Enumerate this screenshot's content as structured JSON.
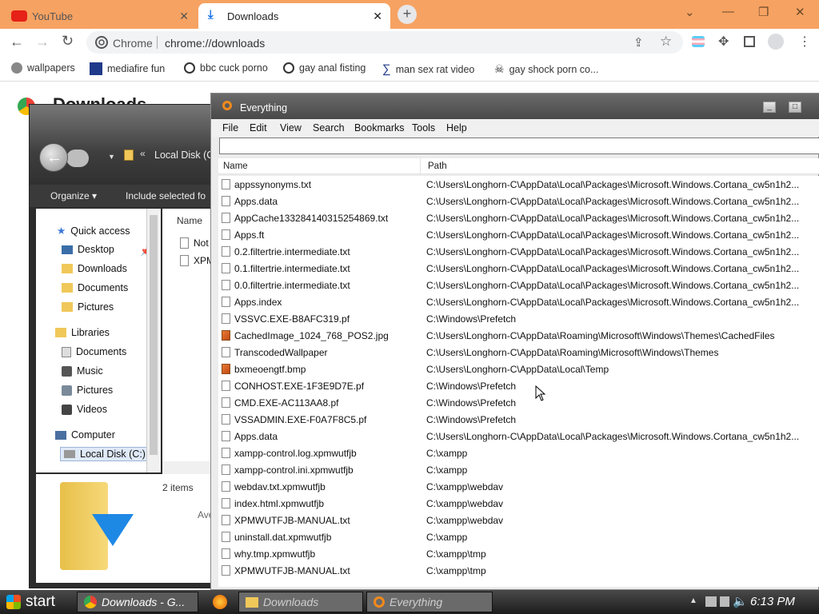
{
  "browser": {
    "tabs": [
      {
        "label": "YouTube"
      },
      {
        "label": "Downloads"
      }
    ],
    "omnibox": {
      "site_label": "Chrome",
      "url": "chrome://downloads"
    },
    "bookmarks": [
      "wallpapers",
      "mediafire fun",
      "bbc cuck porno",
      "gay anal fisting",
      "man sex rat video",
      "gay shock porn co..."
    ],
    "page_title": "Downloads"
  },
  "explorer": {
    "address": "Local Disk (C",
    "address_prefix": "«",
    "commands": {
      "organize": "Organize ▾",
      "include": "Include selected fo"
    },
    "nav": {
      "quick_access": "Quick access",
      "desktop": "Desktop",
      "downloads": "Downloads",
      "documents": "Documents",
      "pictures": "Pictures",
      "libraries": "Libraries",
      "lib_documents": "Documents",
      "music": "Music",
      "lib_pictures": "Pictures",
      "videos": "Videos",
      "computer": "Computer",
      "local_disk": "Local Disk (C:)"
    },
    "column_name": "Name",
    "files": [
      "Not",
      "XPM"
    ],
    "status": "2 items",
    "status_trailing": "Ave"
  },
  "everything": {
    "title": "Everything",
    "menu": [
      "File",
      "Edit",
      "View",
      "Search",
      "Bookmarks",
      "Tools",
      "Help"
    ],
    "search_value": "",
    "columns": {
      "name": "Name",
      "path": "Path"
    },
    "rows": [
      {
        "name": "appssynonyms.txt",
        "path": "C:\\Users\\Longhorn-C\\AppData\\Local\\Packages\\Microsoft.Windows.Cortana_cw5n1h2..."
      },
      {
        "name": "Apps.data",
        "path": "C:\\Users\\Longhorn-C\\AppData\\Local\\Packages\\Microsoft.Windows.Cortana_cw5n1h2..."
      },
      {
        "name": "AppCache133284140315254869.txt",
        "path": "C:\\Users\\Longhorn-C\\AppData\\Local\\Packages\\Microsoft.Windows.Cortana_cw5n1h2..."
      },
      {
        "name": "Apps.ft",
        "path": "C:\\Users\\Longhorn-C\\AppData\\Local\\Packages\\Microsoft.Windows.Cortana_cw5n1h2..."
      },
      {
        "name": "0.2.filtertrie.intermediate.txt",
        "path": "C:\\Users\\Longhorn-C\\AppData\\Local\\Packages\\Microsoft.Windows.Cortana_cw5n1h2..."
      },
      {
        "name": "0.1.filtertrie.intermediate.txt",
        "path": "C:\\Users\\Longhorn-C\\AppData\\Local\\Packages\\Microsoft.Windows.Cortana_cw5n1h2..."
      },
      {
        "name": "0.0.filtertrie.intermediate.txt",
        "path": "C:\\Users\\Longhorn-C\\AppData\\Local\\Packages\\Microsoft.Windows.Cortana_cw5n1h2..."
      },
      {
        "name": "Apps.index",
        "path": "C:\\Users\\Longhorn-C\\AppData\\Local\\Packages\\Microsoft.Windows.Cortana_cw5n1h2..."
      },
      {
        "name": "VSSVC.EXE-B8AFC319.pf",
        "path": "C:\\Windows\\Prefetch"
      },
      {
        "name": "CachedImage_1024_768_POS2.jpg",
        "path": "C:\\Users\\Longhorn-C\\AppData\\Roaming\\Microsoft\\Windows\\Themes\\CachedFiles"
      },
      {
        "name": "TranscodedWallpaper",
        "path": "C:\\Users\\Longhorn-C\\AppData\\Roaming\\Microsoft\\Windows\\Themes"
      },
      {
        "name": "bxmeoengtf.bmp",
        "path": "C:\\Users\\Longhorn-C\\AppData\\Local\\Temp"
      },
      {
        "name": "CONHOST.EXE-1F3E9D7E.pf",
        "path": "C:\\Windows\\Prefetch"
      },
      {
        "name": "CMD.EXE-AC113AA8.pf",
        "path": "C:\\Windows\\Prefetch"
      },
      {
        "name": "VSSADMIN.EXE-F0A7F8C5.pf",
        "path": "C:\\Windows\\Prefetch"
      },
      {
        "name": "Apps.data",
        "path": "C:\\Users\\Longhorn-C\\AppData\\Local\\Packages\\Microsoft.Windows.Cortana_cw5n1h2..."
      },
      {
        "name": "xampp-control.log.xpmwutfjb",
        "path": "C:\\xampp"
      },
      {
        "name": "xampp-control.ini.xpmwutfjb",
        "path": "C:\\xampp"
      },
      {
        "name": "webdav.txt.xpmwutfjb",
        "path": "C:\\xampp\\webdav"
      },
      {
        "name": "index.html.xpmwutfjb",
        "path": "C:\\xampp\\webdav"
      },
      {
        "name": "XPMWUTFJB-MANUAL.txt",
        "path": "C:\\xampp\\webdav"
      },
      {
        "name": "uninstall.dat.xpmwutfjb",
        "path": "C:\\xampp"
      },
      {
        "name": "why.tmp.xpmwutfjb",
        "path": "C:\\xampp\\tmp"
      },
      {
        "name": "XPMWUTFJB-MANUAL.txt",
        "path": "C:\\xampp\\tmp"
      }
    ]
  },
  "taskbar": {
    "start": "start",
    "items": [
      "Downloads - G...",
      "Downloads",
      "Everything"
    ],
    "clock": "6:13 PM"
  },
  "colors": {
    "tabstrip": "#f6a262",
    "accent": "#1a73e8",
    "taskbar": "#1c1c1c"
  }
}
